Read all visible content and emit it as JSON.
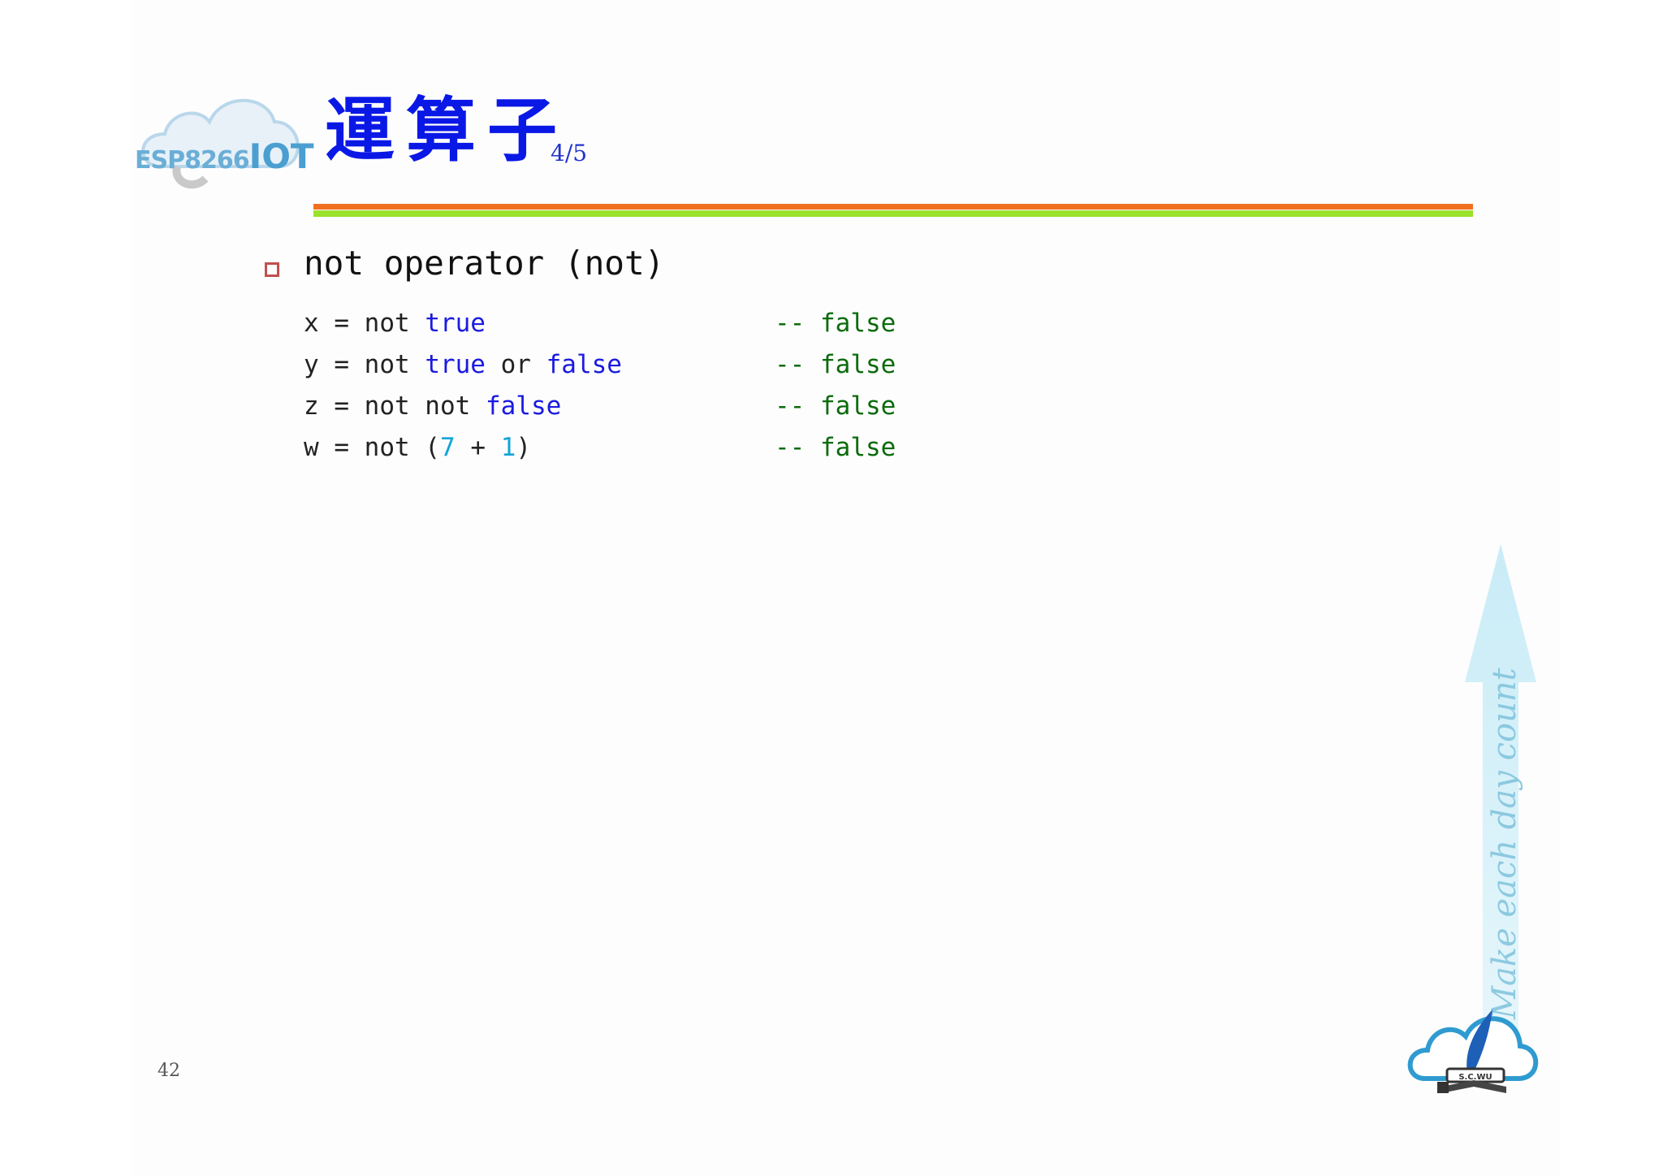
{
  "header": {
    "logo_text": "ESP8266",
    "logo_iot": "IOT",
    "title": "運算子",
    "page_fraction": "4/5"
  },
  "content": {
    "bullet": "not operator (not)",
    "code_lines": [
      {
        "var": "x = not ",
        "parts": [
          {
            "t": "true",
            "k": "kw"
          }
        ],
        "comment": "-- false"
      },
      {
        "var": "y = not ",
        "parts": [
          {
            "t": "true",
            "k": "kw"
          },
          {
            "t": " or ",
            "k": "plain"
          },
          {
            "t": "false",
            "k": "kw"
          }
        ],
        "comment": "-- false"
      },
      {
        "var": "z = not not ",
        "parts": [
          {
            "t": "false",
            "k": "kw"
          }
        ],
        "comment": "-- false"
      },
      {
        "var": "w = not (",
        "parts": [
          {
            "t": "7",
            "k": "num"
          },
          {
            "t": " + ",
            "k": "plain"
          },
          {
            "t": "1",
            "k": "num"
          },
          {
            "t": ")",
            "k": "plain"
          }
        ],
        "comment": "-- false"
      }
    ]
  },
  "footer": {
    "slide_number": "42",
    "motto": "Make each day count",
    "bottom_logo_text": "S.C.WU"
  },
  "colors": {
    "title": "#0a18e6",
    "rule_orange": "#f07020",
    "rule_green": "#9be22a",
    "keyword": "#1b1be0",
    "number": "#12a4d6",
    "comment": "#0b6b0b",
    "bullet": "#c0504d"
  }
}
